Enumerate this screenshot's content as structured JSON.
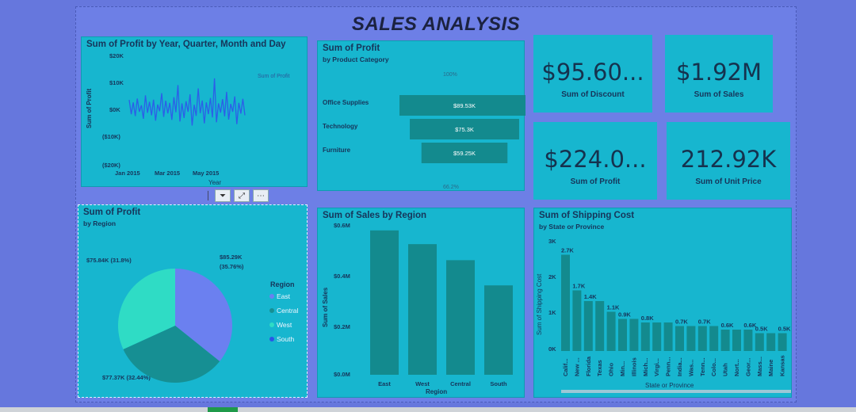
{
  "title": "SALES ANALYSIS",
  "kpis": {
    "discount": {
      "value": "$95.60...",
      "label": "Sum of Discount"
    },
    "sales": {
      "value": "$1.92M",
      "label": "Sum of Sales"
    },
    "profit": {
      "value": "$224.0...",
      "label": "Sum of Profit"
    },
    "unit_price": {
      "value": "212.92K",
      "label": "Sum of Unit Price"
    }
  },
  "profit_time": {
    "title": "Sum of Profit by Year, Quarter, Month and Day",
    "legend": "Sum of Profit",
    "ylabel": "Sum of Profit",
    "xlabel": "Year",
    "yticks": [
      "$20K",
      "$10K",
      "$0K",
      "($10K)",
      "($20K)"
    ],
    "xticks": [
      "Jan 2015",
      "Mar 2015",
      "May 2015"
    ]
  },
  "funnel": {
    "title": "Sum of Profit",
    "subtitle": "by Product Category",
    "top_pct": "100%",
    "bottom_pct": "66.2%",
    "categories": [
      "Office Supplies",
      "Technology",
      "Furniture"
    ],
    "labels": [
      "$89.53K",
      "$75.3K",
      "$59.25K"
    ]
  },
  "pie": {
    "title": "Sum of Profit",
    "subtitle": "by Region",
    "legend_title": "Region",
    "legend": [
      "East",
      "Central",
      "West",
      "South"
    ],
    "labels": {
      "top_right": "$85.29K",
      "top_right_pct": "(35.76%)",
      "left": "$75.84K (31.8%)",
      "bottom": "$77.37K (32.44%)"
    }
  },
  "region_bar": {
    "title": "Sum of Sales by Region",
    "ylabel": "Sum of Sales",
    "xlabel": "Region",
    "yticks": [
      "$0.6M",
      "$0.4M",
      "$0.2M",
      "$0.0M"
    ]
  },
  "shipping": {
    "title": "Sum of Shipping Cost",
    "subtitle": "by State or Province",
    "ylabel": "Sum of Shipping Cost",
    "xlabel": "State or Province",
    "yticks": [
      "3K",
      "2K",
      "1K",
      "0K"
    ]
  },
  "toolbar": {
    "filter": "⏷",
    "focus": "⤢",
    "more": "⋯"
  },
  "chart_data": [
    {
      "type": "line",
      "title": "Sum of Profit by Year, Quarter, Month and Day",
      "xlabel": "Year",
      "ylabel": "Sum of Profit",
      "ylim": [
        -20000,
        20000
      ],
      "x": [
        "Jan 2015",
        "Mar 2015",
        "May 2015"
      ],
      "series": [
        {
          "name": "Sum of Profit",
          "values": [
            3500,
            -1800,
            2600,
            -2500,
            4000,
            -900,
            1500,
            -3500,
            5200,
            -1300,
            2800,
            -2200,
            3600,
            -4200,
            1800,
            -700,
            6000,
            -2800,
            3200,
            -1500,
            2400,
            -3900,
            4500,
            -1100,
            9000,
            -4500,
            2200,
            -3200,
            3000,
            -900,
            5600,
            -6000,
            1700,
            -2400,
            7800,
            -1400,
            3300,
            -5200,
            2600,
            -1800,
            4200,
            -3000,
            11500,
            -4800,
            2200,
            -1200,
            3800,
            -2600,
            6500,
            -3800,
            2000,
            -900,
            4800,
            -5500,
            2400,
            -1600,
            3900,
            -2200
          ]
        }
      ]
    },
    {
      "type": "bar",
      "title": "Sum of Profit",
      "subtitle": "by Product Category",
      "categories": [
        "Office Supplies",
        "Technology",
        "Furniture"
      ],
      "values": [
        89530,
        75300,
        59250
      ]
    },
    {
      "type": "pie",
      "title": "Sum of Profit",
      "subtitle": "by Region",
      "categories": [
        "East",
        "Central",
        "West",
        "South"
      ],
      "values": [
        85290,
        77370,
        75840,
        0
      ],
      "colors": [
        "#6b80f0",
        "#168f93",
        "#2fdcc5",
        "#2a56e6"
      ]
    },
    {
      "type": "bar",
      "title": "Sum of Sales by Region",
      "xlabel": "Region",
      "ylabel": "Sum of Sales",
      "categories": [
        "East",
        "West",
        "Central",
        "South"
      ],
      "values": [
        0.63,
        0.57,
        0.5,
        0.39
      ],
      "ylim": [
        0,
        0.6
      ]
    },
    {
      "type": "bar",
      "title": "Sum of Shipping Cost",
      "subtitle": "by State or Province",
      "xlabel": "State or Province",
      "ylabel": "Sum of Shipping Cost",
      "ylim": [
        0,
        3
      ],
      "categories": [
        "Calif...",
        "New ...",
        "Florida",
        "Texas",
        "Ohio",
        "Min...",
        "Illinois",
        "Mich...",
        "Virgi...",
        "Penn...",
        "India...",
        "Was...",
        "Tenn...",
        "Colo...",
        "Utah",
        "Nort...",
        "Geor...",
        "Mass...",
        "Maine",
        "Kansas"
      ],
      "values": [
        2.7,
        1.7,
        1.4,
        1.4,
        1.1,
        0.9,
        0.9,
        0.8,
        0.8,
        0.8,
        0.7,
        0.7,
        0.7,
        0.7,
        0.6,
        0.6,
        0.6,
        0.5,
        0.5,
        0.5
      ],
      "data_labels": [
        "2.7K",
        "1.7K",
        "1.4K",
        "",
        "1.1K",
        "0.9K",
        "",
        "0.8K",
        "",
        "",
        "0.7K",
        "",
        "0.7K",
        "",
        "0.6K",
        "",
        "0.6K",
        "0.5K",
        "",
        "0.5K"
      ]
    }
  ]
}
